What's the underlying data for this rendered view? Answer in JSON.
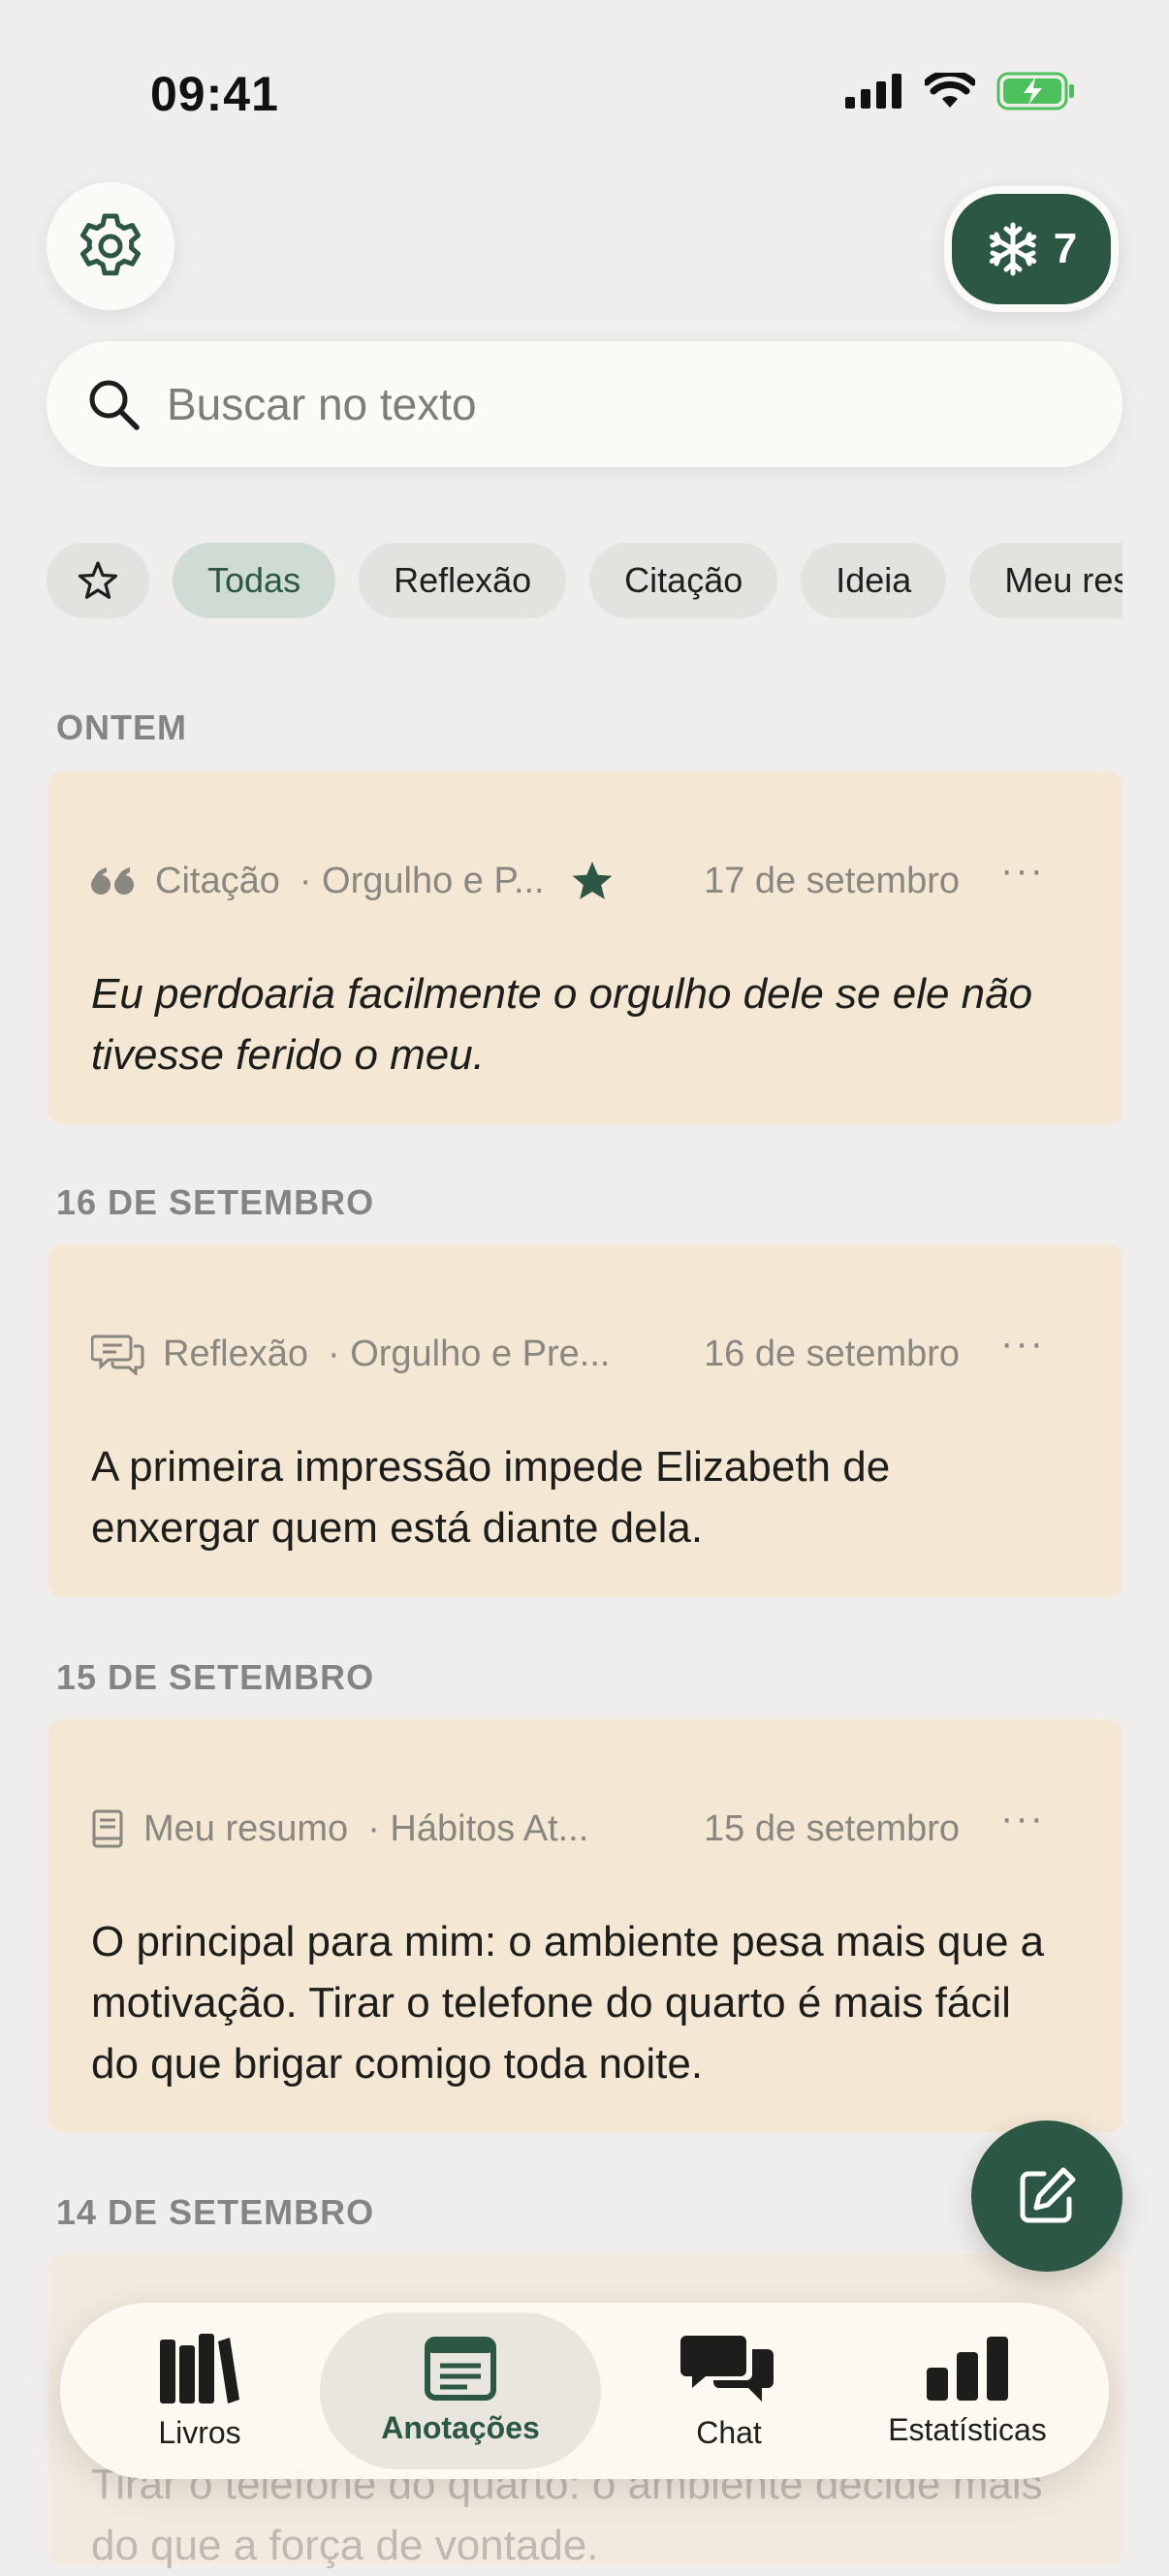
{
  "status_bar": {
    "time": "09:41"
  },
  "header": {
    "streak_count": "7",
    "settings_icon": "gear-icon",
    "streak_icon": "snowflake-icon"
  },
  "search": {
    "placeholder": "Buscar no texto"
  },
  "filters": {
    "items": [
      "Todas",
      "Reflexão",
      "Citação",
      "Ideia",
      "Meu resumo"
    ],
    "selected": "Todas"
  },
  "sections": [
    {
      "label": "ONTEM",
      "card": {
        "type": "Citação",
        "book": "· Orgulho e P...",
        "starred": true,
        "date": "17 de setembro",
        "text": "Eu perdoaria facilmente o orgulho dele se ele não tivesse ferido o meu."
      }
    },
    {
      "label": "16 DE SETEMBRO",
      "card": {
        "type": "Reflexão",
        "book": "· Orgulho e Pre...",
        "date": "16 de setembro",
        "text": "A primeira impressão impede Elizabeth de enxergar quem está diante dela."
      }
    },
    {
      "label": "15 DE SETEMBRO",
      "card": {
        "type": "Meu resumo",
        "book": "· Hábitos At...",
        "date": "15 de setembro",
        "text": "O principal para mim: o ambiente pesa mais que a motivação. Tirar o telefone do quarto é mais fácil do que brigar comigo toda noite."
      }
    },
    {
      "label": "14 DE SETEMBRO",
      "card": {
        "text": "Tirar o telefone do quarto: o ambiente decide mais do que a força de vontade."
      }
    }
  ],
  "more_label": "···",
  "tabbar": {
    "tabs": [
      {
        "label": "Livros",
        "icon": "books-icon"
      },
      {
        "label": "Anotações",
        "icon": "notes-icon",
        "active": true
      },
      {
        "label": "Chat",
        "icon": "chat-icon"
      },
      {
        "label": "Estatísticas",
        "icon": "stats-icon"
      }
    ]
  },
  "colors": {
    "accent": "#2b5744",
    "card": "#f4e7d4",
    "background": "#efeeec"
  }
}
